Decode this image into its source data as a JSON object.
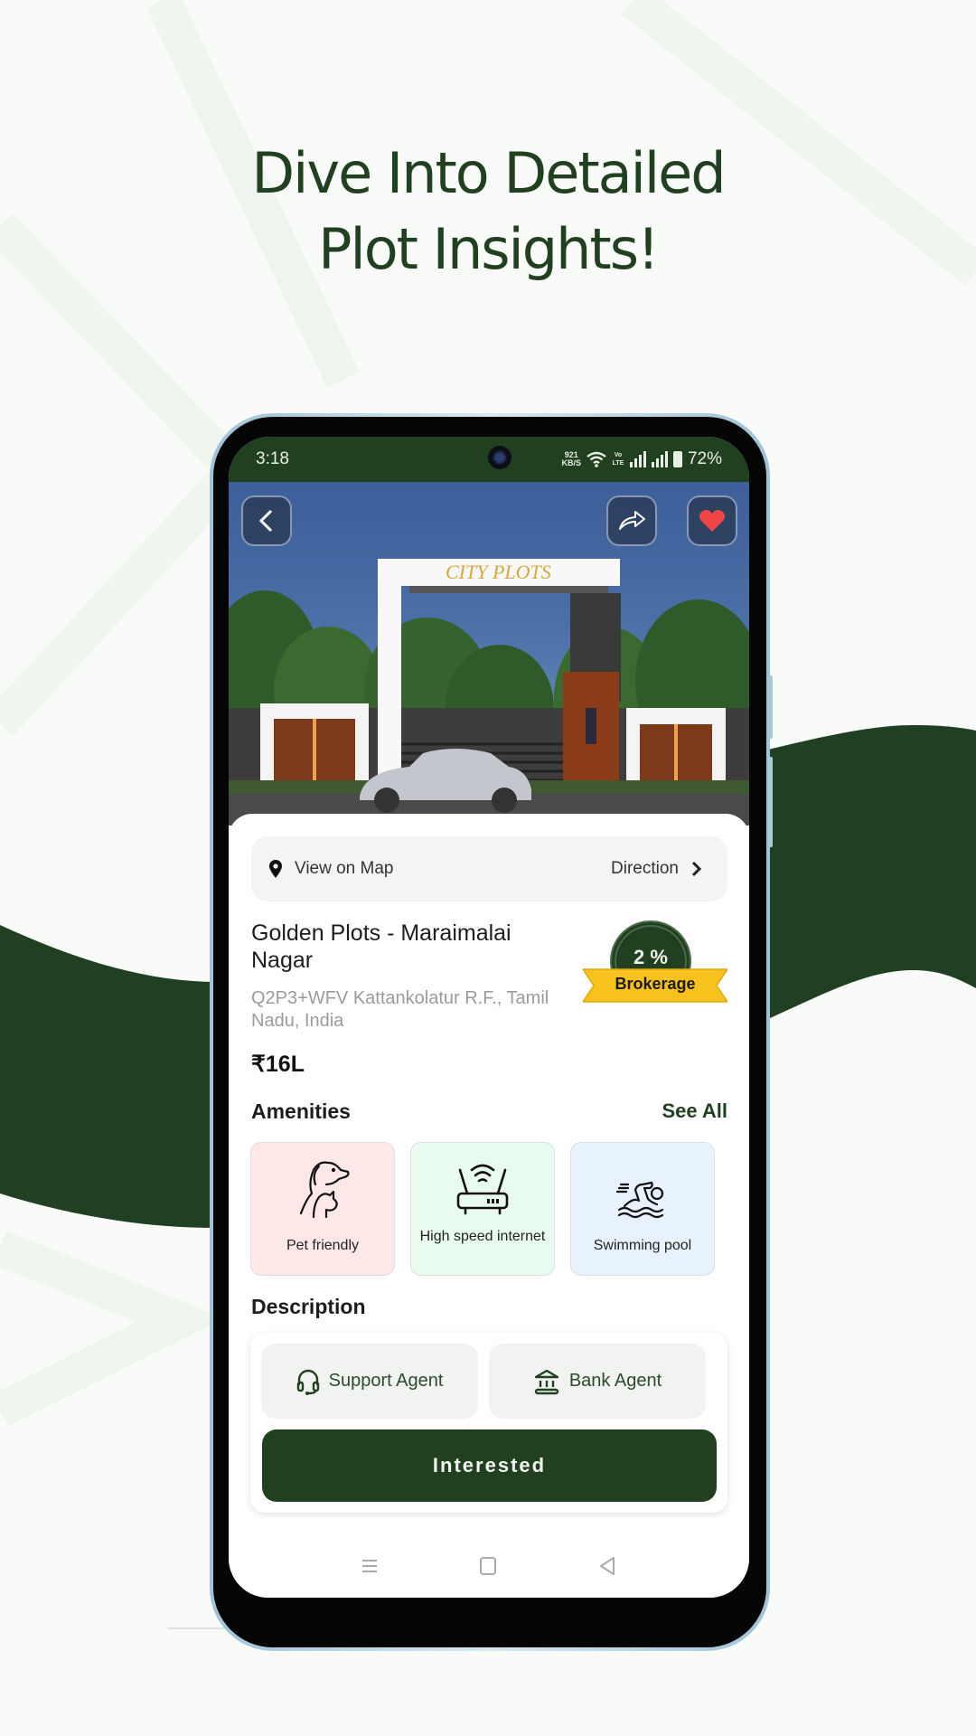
{
  "promo": {
    "headline_line1": "Dive Into Detailed",
    "headline_line2": "Plot Insights!",
    "accent_color": "#21401f"
  },
  "status_bar": {
    "time": "3:18",
    "speed_value": "921",
    "speed_unit": "KB/S",
    "volte": "Vo LTE",
    "battery": "72%",
    "icons": [
      "wifi-icon",
      "volte-icon",
      "signal-icon",
      "signal-icon",
      "battery-icon"
    ]
  },
  "hero": {
    "image_alt": "City Plots entrance gate",
    "gate_sign": "CITY PLOTS",
    "back_icon": "chevron-left-icon",
    "share_icon": "share-icon",
    "favorite_icon": "heart-icon",
    "favorite_active": true
  },
  "map_row": {
    "view_on_map": "View on Map",
    "direction": "Direction"
  },
  "property": {
    "title": "Golden Plots - Maraimalai Nagar",
    "address": "Q2P3+WFV Kattankolatur R.F., Tamil Nadu, India",
    "price": "₹16L",
    "brokerage_value": "2 %",
    "brokerage_label": "Brokerage"
  },
  "amenities": {
    "heading": "Amenities",
    "see_all": "See All",
    "items": [
      {
        "label": "Pet friendly",
        "icon": "pet-icon",
        "bg": "#fde8e7"
      },
      {
        "label": "High speed internet",
        "icon": "router-icon",
        "bg": "#e8fbee"
      },
      {
        "label": "Swimming pool",
        "icon": "swimmer-icon",
        "bg": "#e8f2fd"
      }
    ]
  },
  "description": {
    "heading": "Description",
    "support_agent": "Support Agent",
    "bank_agent": "Bank Agent",
    "interested": "Interested"
  },
  "navbar": {
    "icons": [
      "menu-icon",
      "home-icon",
      "back-icon"
    ]
  }
}
